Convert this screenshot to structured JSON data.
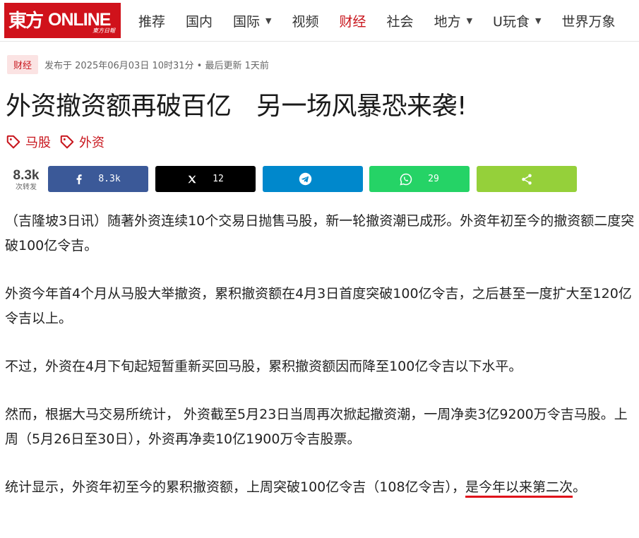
{
  "header": {
    "logo": {
      "brand_cn": "東方",
      "brand_en": "ONLINE",
      "brand_sub": "東方日報"
    },
    "nav": [
      {
        "label": "推荐",
        "dropdown": false,
        "active": false
      },
      {
        "label": "国内",
        "dropdown": false,
        "active": false
      },
      {
        "label": "国际",
        "dropdown": true,
        "active": false
      },
      {
        "label": "视频",
        "dropdown": false,
        "active": false
      },
      {
        "label": "财经",
        "dropdown": false,
        "active": true
      },
      {
        "label": "社会",
        "dropdown": false,
        "active": false
      },
      {
        "label": "地方",
        "dropdown": true,
        "active": false
      },
      {
        "label": "U玩食",
        "dropdown": true,
        "active": false
      },
      {
        "label": "世界万象",
        "dropdown": false,
        "active": false
      }
    ]
  },
  "meta": {
    "category": "财经",
    "published": "发布于 2025年06月03日 10时31分 • 最后更新 1天前"
  },
  "article": {
    "title": "外资撤资额再破百亿　另一场风暴恐来袭!",
    "tags": [
      "马股",
      "外资"
    ],
    "share": {
      "total": "8.3k",
      "total_label": "次转发",
      "facebook": "8.3k",
      "x": "12",
      "telegram": "",
      "whatsapp": "29",
      "share": ""
    },
    "paragraphs": [
      "（吉隆坡3日讯）随著外资连续10个交易日抛售马股，新一轮撤资潮已成形。外资年初至今的撤资额二度突破100亿令吉。",
      "外资今年首4个月从马股大举撤资，累积撤资额在4月3日首度突破100亿令吉，之后甚至一度扩大至120亿令吉以上。",
      "不过，外资在4月下旬起短暂重新买回马股，累积撤资额因而降至100亿令吉以下水平。",
      "然而，根据大马交易所统计， 外资截至5月23日当周再次掀起撤资潮，一周净卖3亿9200万令吉马股。上周（5月26日至30日），外资再净卖10亿1900万令吉股票。"
    ],
    "last_paragraph": {
      "text": "统计显示，外资年初至今的累积撤资额，上周突破100亿令吉（108亿令吉），",
      "highlight": "是今年以来第二次",
      "end": "。"
    }
  },
  "colors": {
    "brand_red": "#d0121b",
    "accent_red": "#c8161d",
    "facebook": "#3b5998",
    "x": "#000000",
    "telegram": "#0088cc",
    "whatsapp": "#25d366",
    "share": "#95d03a"
  }
}
